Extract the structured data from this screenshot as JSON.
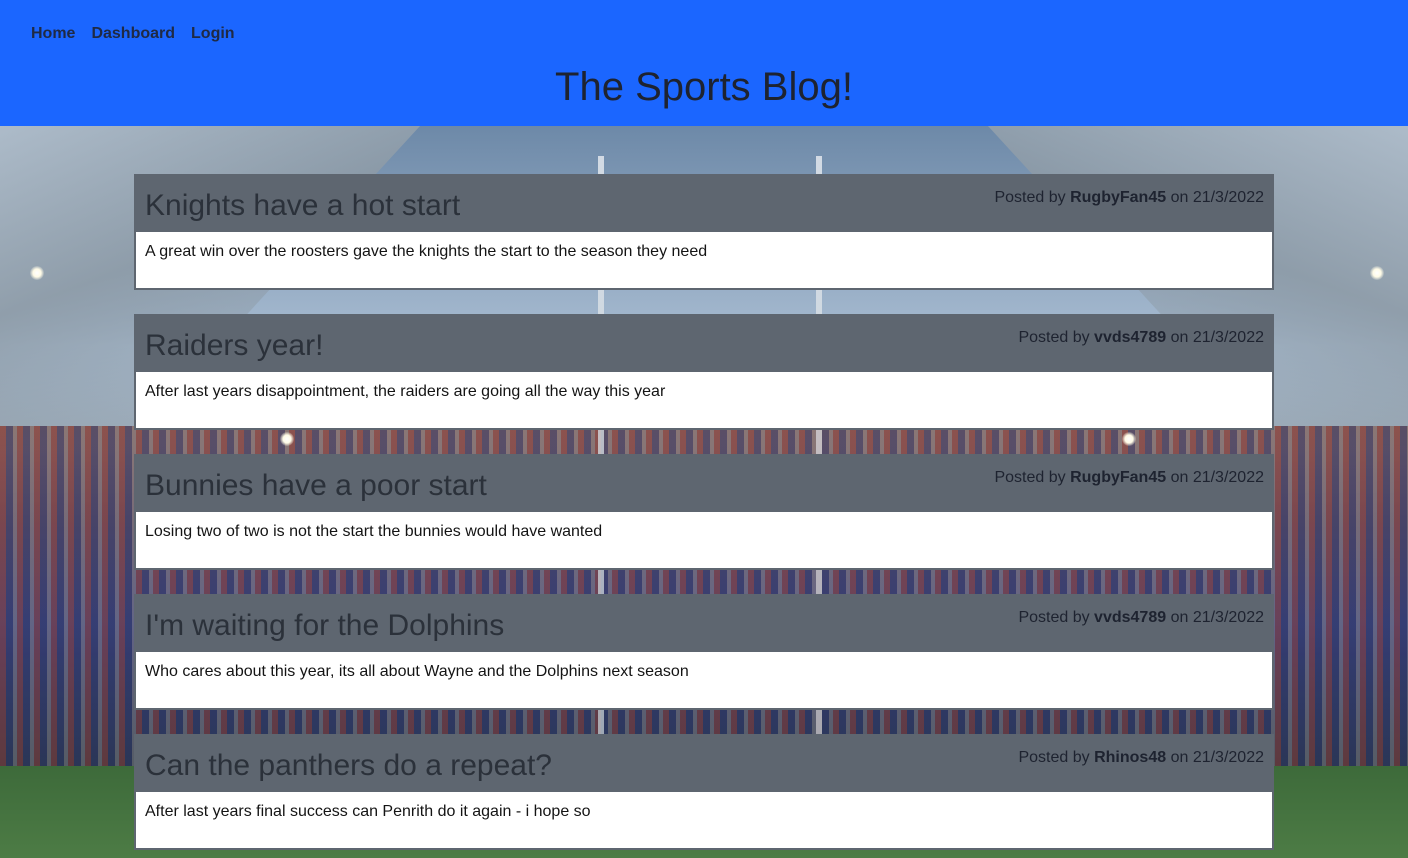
{
  "nav": {
    "items": [
      "Home",
      "Dashboard",
      "Login"
    ]
  },
  "header": {
    "title": "The Sports Blog!"
  },
  "posts": [
    {
      "title": "Knights have a hot start",
      "posted_prefix": "Posted by",
      "author": "RugbyFan45",
      "on_word": "on",
      "date": "21/3/2022",
      "body": "A great win over the roosters gave the knights the start to the season they need"
    },
    {
      "title": "Raiders year!",
      "posted_prefix": "Posted by",
      "author": "vvds4789",
      "on_word": "on",
      "date": "21/3/2022",
      "body": "After last years disappointment, the raiders are going all the way this year"
    },
    {
      "title": "Bunnies have a poor start",
      "posted_prefix": "Posted by",
      "author": "RugbyFan45",
      "on_word": "on",
      "date": "21/3/2022",
      "body": "Losing two of two is not the start the bunnies would have wanted"
    },
    {
      "title": "I'm waiting for the Dolphins",
      "posted_prefix": "Posted by",
      "author": "vvds4789",
      "on_word": "on",
      "date": "21/3/2022",
      "body": "Who cares about this year, its all about Wayne and the Dolphins next season"
    },
    {
      "title": "Can the panthers do a repeat?",
      "posted_prefix": "Posted by",
      "author": "Rhinos48",
      "on_word": "on",
      "date": "21/3/2022",
      "body": "After last years final success can Penrith do it again - i hope so"
    }
  ],
  "colors": {
    "header_bg": "#1b66ff",
    "post_header_bg": "#5e6670",
    "post_body_bg": "#ffffff"
  }
}
